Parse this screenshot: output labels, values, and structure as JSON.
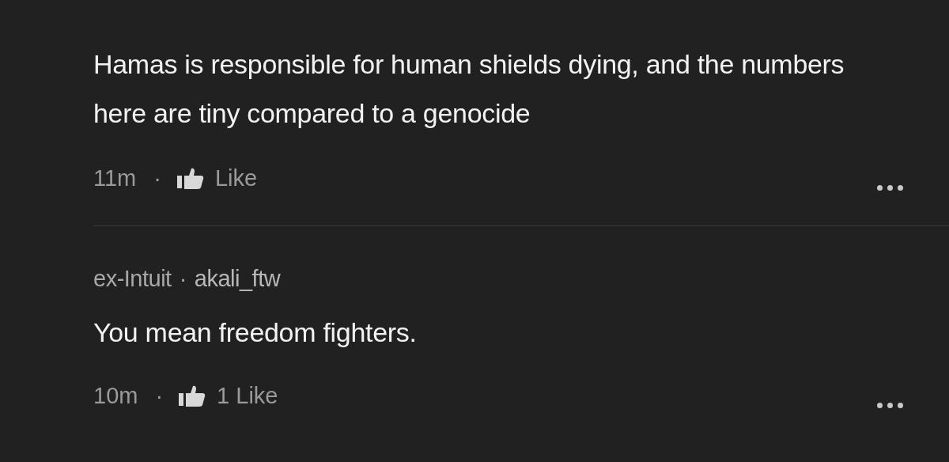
{
  "comments": [
    {
      "text": "Hamas is responsible for human shields dying, and the numbers here are tiny compared to a genocide",
      "time": "11m",
      "separator": "·",
      "like_label": "Like"
    },
    {
      "company": "ex-Intuit",
      "author_separator": "·",
      "username": "akali_ftw",
      "text": "You mean freedom fighters.",
      "time": "10m",
      "separator": "·",
      "like_label": "1 Like"
    }
  ]
}
